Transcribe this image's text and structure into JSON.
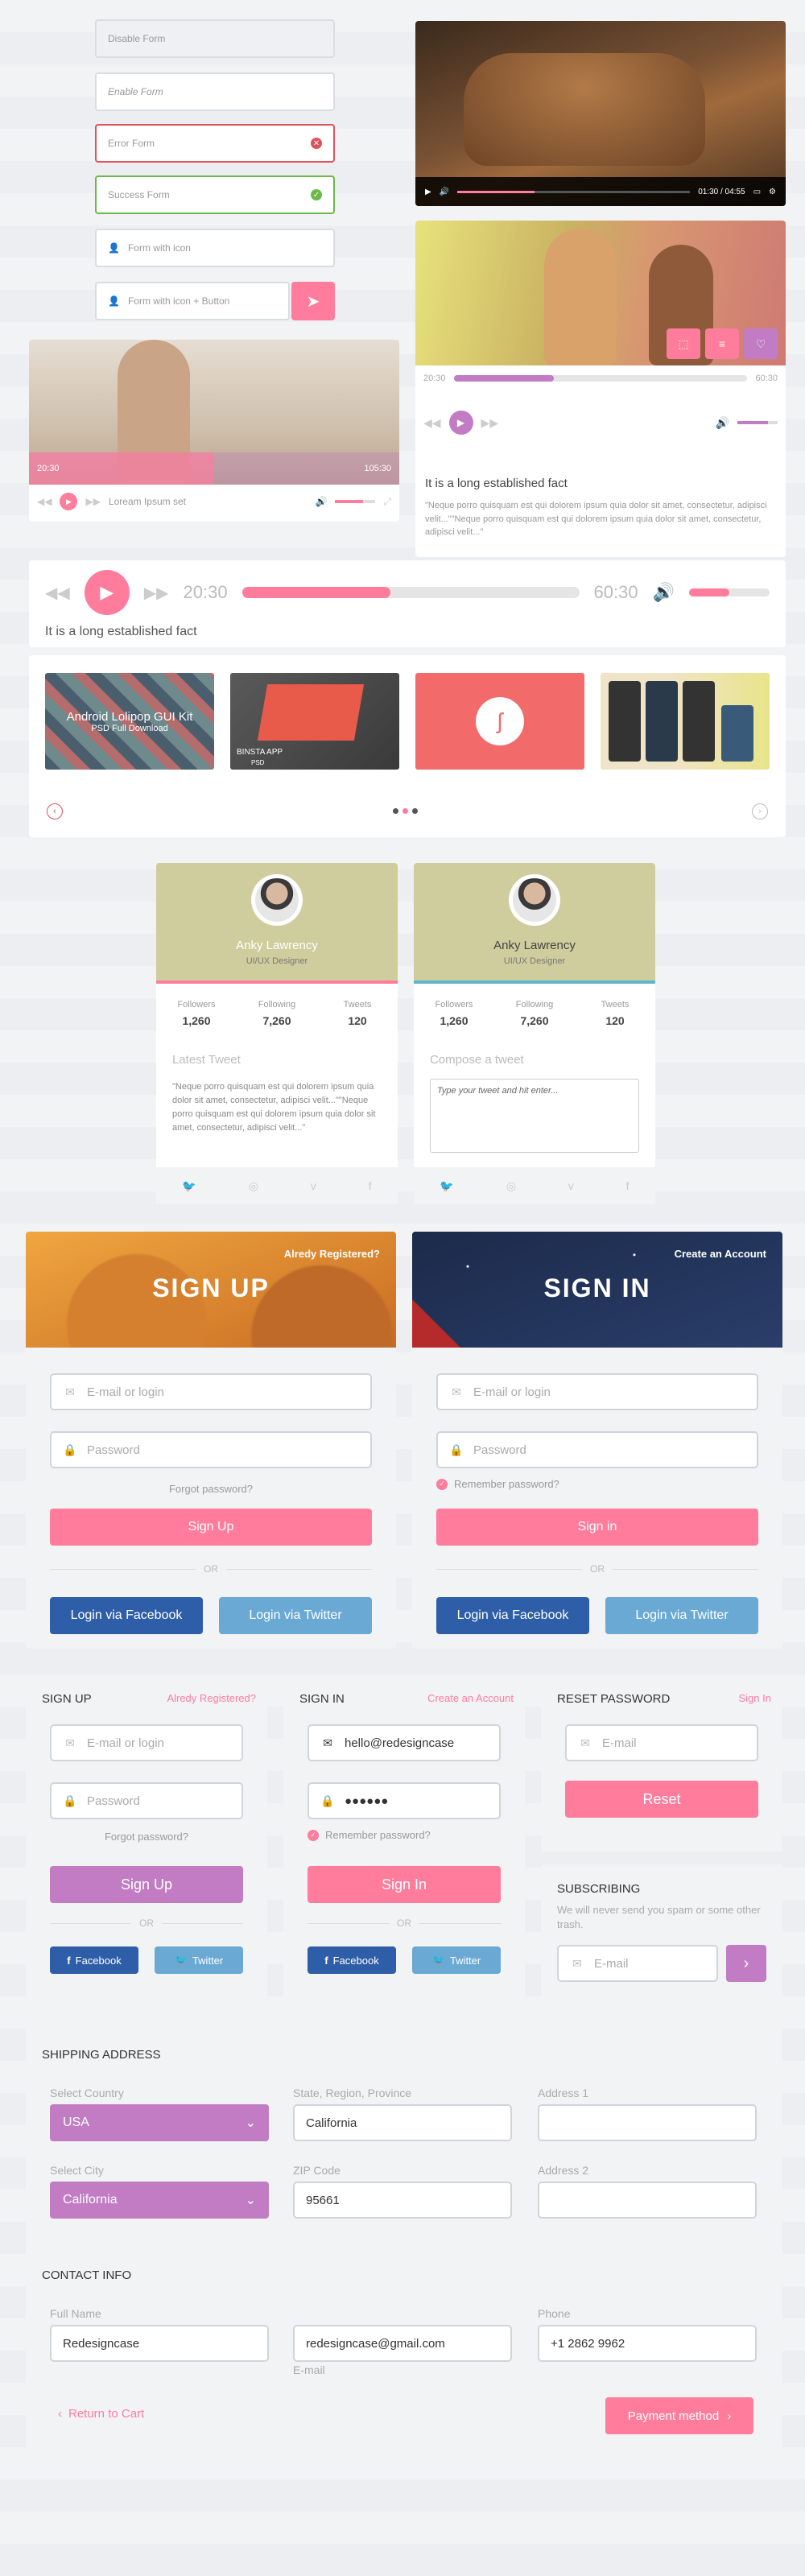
{
  "forms": {
    "disable": "Disable Form",
    "enable": "Enable Form",
    "error": "Error Form",
    "success": "Success Form",
    "icon": "Form with icon",
    "icon_button": "Form with icon + Button"
  },
  "video1": {
    "time": "01:30 / 04:55"
  },
  "video2": {
    "current": "20:30",
    "total": "60:30",
    "title": "It is a long established fact",
    "text": "\"Neque porro quisquam est qui dolorem ipsum quia dolor sit amet, consectetur, adipisci velit...\"\"Neque porro quisquam est qui dolorem ipsum quia dolor sit amet, consectetur, adipisci velit...\"",
    "progress": 0.34,
    "volume": 0.75
  },
  "video3": {
    "current": "20:30",
    "total": "105:30",
    "caption": "Loream Ipsum set",
    "progress": 0.5
  },
  "player": {
    "current": "20:30",
    "total": "60:30",
    "title": "It is a long established fact",
    "progress": 0.44,
    "volume": 0.5
  },
  "carousel": {
    "items": [
      {
        "title": "Android Lolipop GUI Kit",
        "sub": "PSD Full Download"
      },
      {
        "title": "BINSTA APP",
        "sub": "PSD"
      },
      {
        "title": "",
        "sub": ""
      },
      {
        "title": "",
        "sub": ""
      }
    ]
  },
  "profile1": {
    "name": "Anky Lawrency",
    "role": "UI/UX Designer",
    "followers_label": "Followers",
    "followers": "1,260",
    "following_label": "Following",
    "following": "7,260",
    "tweets_label": "Tweets",
    "tweets": "120",
    "section": "Latest Tweet",
    "tweet": "\"Neque porro quisquam est qui dolorem ipsum quia dolor sit amet, consectetur, adipisci velit...\"\"Neque porro quisquam est qui dolorem ipsum quia dolor sit amet, consectetur, adipisci velit...\""
  },
  "profile2": {
    "name": "Anky Lawrency",
    "role": "UI/UX Designer",
    "followers_label": "Followers",
    "followers": "1,260",
    "following_label": "Following",
    "following": "7,260",
    "tweets_label": "Tweets",
    "tweets": "120",
    "section": "Compose a tweet",
    "placeholder": "Type your tweet and hit enter..."
  },
  "signup_big": {
    "title": "SIGN UP",
    "link": "Alredy Registered?",
    "email": "E-mail or login",
    "password": "Password",
    "forgot": "Forgot password?",
    "button": "Sign Up",
    "or": "OR",
    "fb": "Login via Facebook",
    "tw": "Login via Twitter"
  },
  "signin_big": {
    "title": "SIGN IN",
    "link": "Create an Account",
    "email": "E-mail or login",
    "password": "Password",
    "remember": "Remember password?",
    "button": "Sign in",
    "or": "OR",
    "fb": "Login via Facebook",
    "tw": "Login via Twitter"
  },
  "signup_sm": {
    "title": "SIGN UP",
    "link": "Alredy Registered?",
    "email": "E-mail or login",
    "password": "Password",
    "forgot": "Forgot password?",
    "button": "Sign Up",
    "or": "OR",
    "fb": "Facebook",
    "tw": "Twitter"
  },
  "signin_sm": {
    "title": "SIGN IN",
    "link": "Create an Account",
    "email": "hello@redesigncase",
    "password": "●●●●●●",
    "remember": "Remember password?",
    "button": "Sign In",
    "or": "OR",
    "fb": "Facebook",
    "tw": "Twitter"
  },
  "reset": {
    "title": "RESET PASSWORD",
    "link": "Sign In",
    "email": "E-mail",
    "button": "Reset"
  },
  "subscribe": {
    "title": "SUBSCRIBING",
    "text": "We will never send you spam or some other trash.",
    "email": "E-mail"
  },
  "shipping": {
    "title": "SHIPPING ADDRESS",
    "country_label": "Select Country",
    "country": "USA",
    "state_label": "State, Region, Province",
    "state": "California",
    "addr1_label": "Address 1",
    "addr1": "",
    "city_label": "Select City",
    "city": "California",
    "zip_label": "ZIP Code",
    "zip": "95661",
    "addr2_label": "Address 2",
    "addr2": ""
  },
  "contact": {
    "title": "CONTACT INFO",
    "name_label": "Full Name",
    "name": "Redesigncase",
    "email": "redesigncase@gmail.com",
    "email_label": "E-mail",
    "phone_label": "Phone",
    "phone": "+1 2862 9962",
    "back": "Return to Cart",
    "pay": "Payment method"
  },
  "colors": {
    "pink": "#ff7c9c",
    "purple": "#c27cc4",
    "facebook": "#2e5ea8",
    "twitter": "#6aa9d4"
  }
}
